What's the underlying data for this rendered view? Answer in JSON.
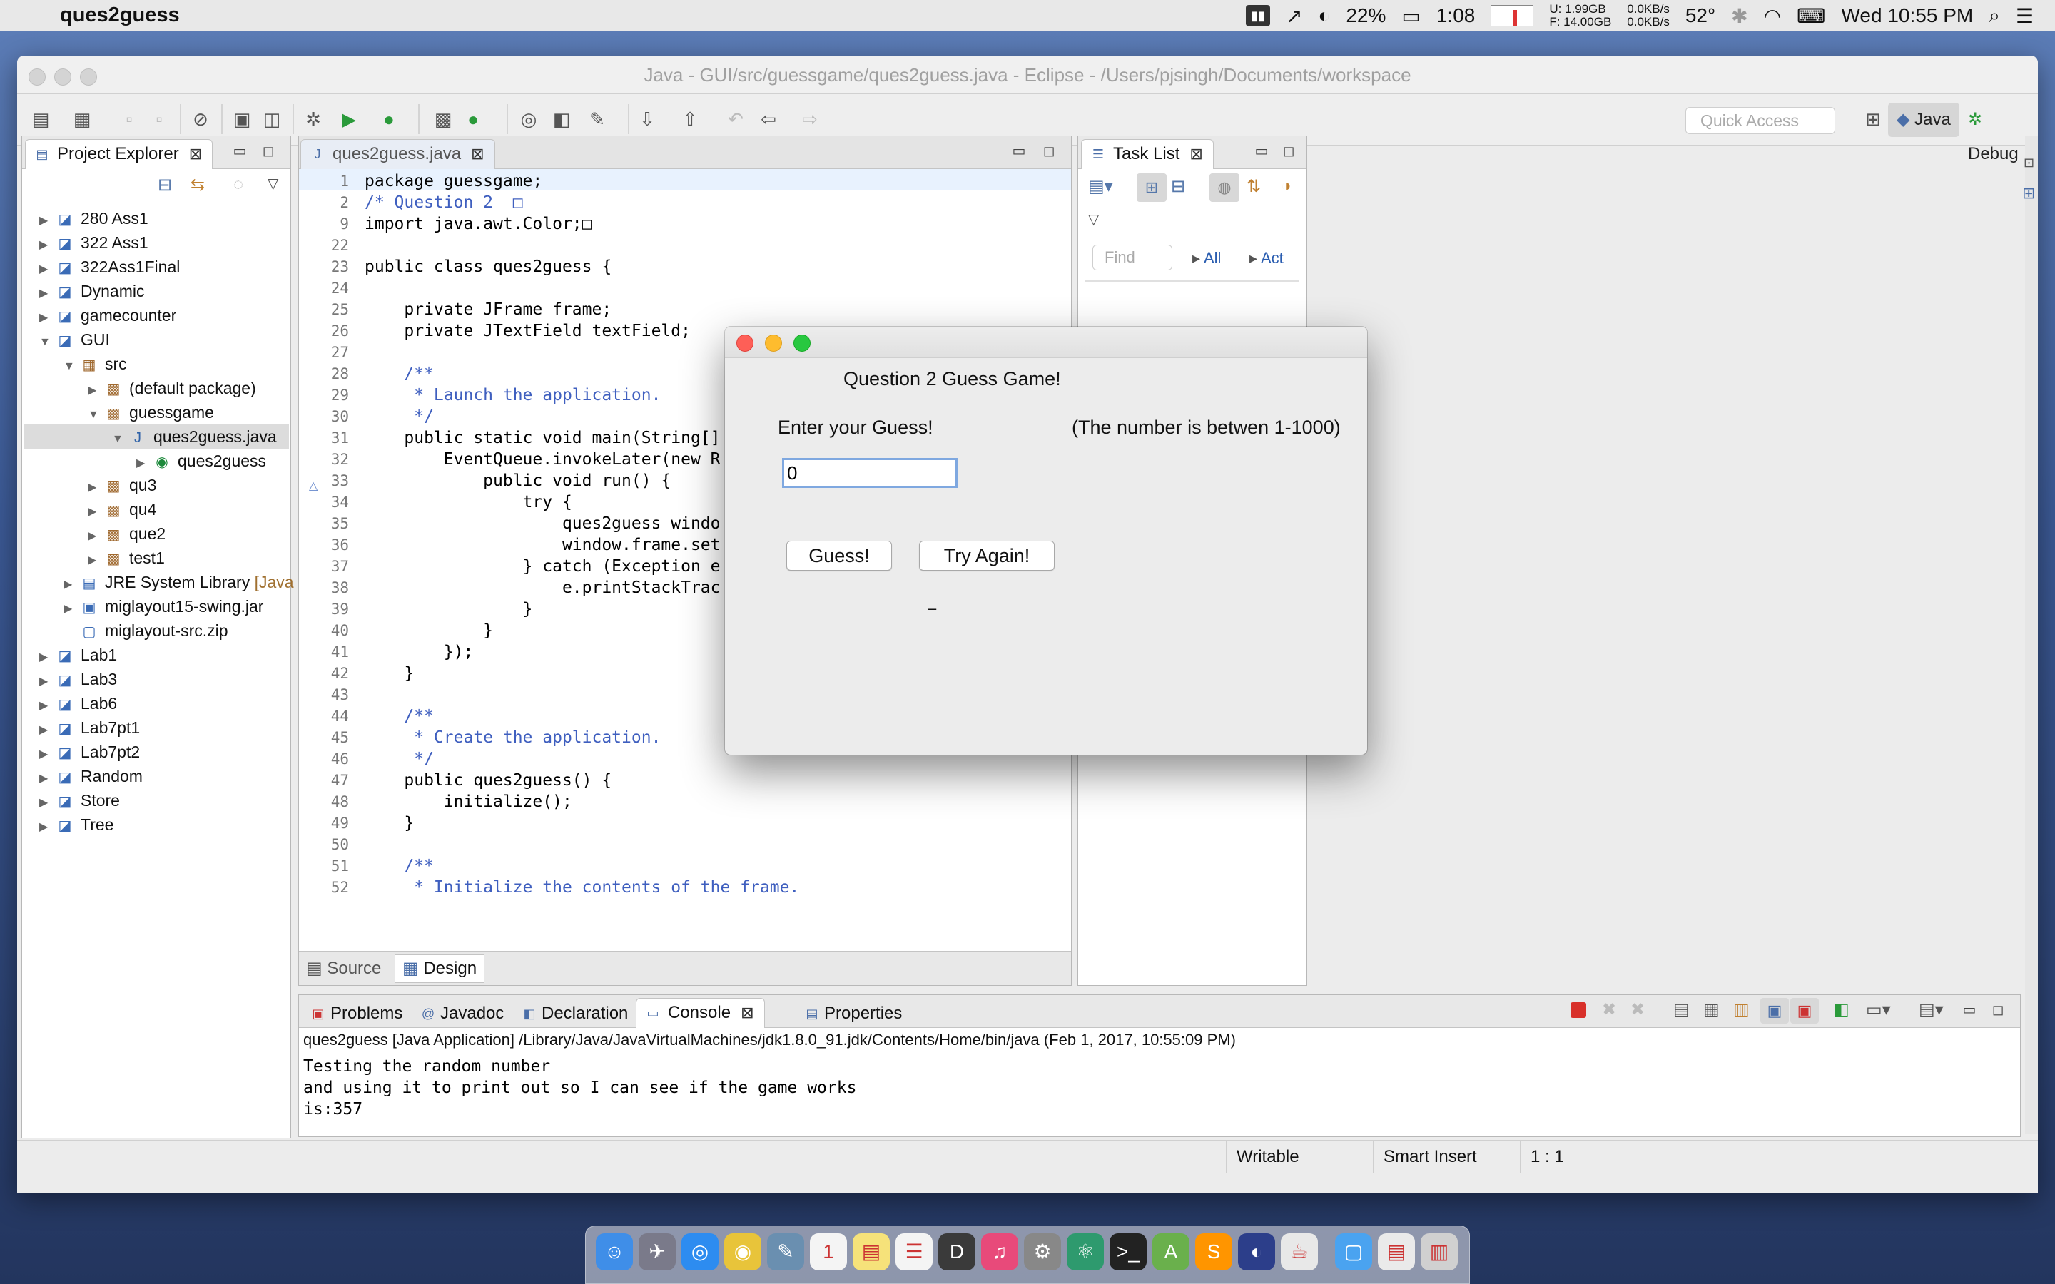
{
  "menubar": {
    "app_name": "ques2guess",
    "battery_percent": "22%",
    "battery_time": "1:08",
    "memory_used": "U:  1.99GB",
    "memory_free": "F: 14.00GB",
    "net_up": "0.0KB/s",
    "net_down": "0.0KB/s",
    "temperature": "52°",
    "clock": "Wed 10:55 PM"
  },
  "window": {
    "title": "Java - GUI/src/guessgame/ques2guess.java - Eclipse - /Users/pjsingh/Documents/workspace"
  },
  "toolbar": {
    "quick_access_placeholder": "Quick Access",
    "perspective_java": "Java",
    "perspective_debug": "Debug"
  },
  "project_explorer": {
    "tab_label": "Project Explorer",
    "items": [
      {
        "label": "280 Ass1",
        "depth": 0,
        "arrow": "▶",
        "icon": "project-icon"
      },
      {
        "label": "322 Ass1",
        "depth": 0,
        "arrow": "▶",
        "icon": "project-icon"
      },
      {
        "label": "322Ass1Final",
        "depth": 0,
        "arrow": "▶",
        "icon": "project-icon"
      },
      {
        "label": "Dynamic",
        "depth": 0,
        "arrow": "▶",
        "icon": "project-icon"
      },
      {
        "label": "gamecounter",
        "depth": 0,
        "arrow": "▶",
        "icon": "project-icon"
      },
      {
        "label": "GUI",
        "depth": 0,
        "arrow": "▼",
        "icon": "project-icon"
      },
      {
        "label": "src",
        "depth": 1,
        "arrow": "▼",
        "icon": "source-folder-icon"
      },
      {
        "label": "(default package)",
        "depth": 2,
        "arrow": "▶",
        "icon": "package-icon"
      },
      {
        "label": "guessgame",
        "depth": 2,
        "arrow": "▼",
        "icon": "package-icon"
      },
      {
        "label": "ques2guess.java",
        "depth": 3,
        "arrow": "▼",
        "icon": "java-file-icon"
      },
      {
        "label": "ques2guess",
        "depth": 4,
        "arrow": "▶",
        "icon": "class-icon"
      },
      {
        "label": "qu3",
        "depth": 2,
        "arrow": "▶",
        "icon": "package-icon"
      },
      {
        "label": "qu4",
        "depth": 2,
        "arrow": "▶",
        "icon": "package-icon"
      },
      {
        "label": "que2",
        "depth": 2,
        "arrow": "▶",
        "icon": "package-icon"
      },
      {
        "label": "test1",
        "depth": 2,
        "arrow": "▶",
        "icon": "package-icon"
      },
      {
        "label": "JRE System Library",
        "suffix": " [Java",
        "depth": 1,
        "arrow": "▶",
        "icon": "library-icon"
      },
      {
        "label": "miglayout15-swing.jar",
        "depth": 1,
        "arrow": "▶",
        "icon": "jar-icon"
      },
      {
        "label": "miglayout-src.zip",
        "depth": 1,
        "arrow": "",
        "icon": "zip-icon"
      },
      {
        "label": "Lab1",
        "depth": 0,
        "arrow": "▶",
        "icon": "project-icon"
      },
      {
        "label": "Lab3",
        "depth": 0,
        "arrow": "▶",
        "icon": "project-icon"
      },
      {
        "label": "Lab6",
        "depth": 0,
        "arrow": "▶",
        "icon": "project-icon"
      },
      {
        "label": "Lab7pt1",
        "depth": 0,
        "arrow": "▶",
        "icon": "project-icon"
      },
      {
        "label": "Lab7pt2",
        "depth": 0,
        "arrow": "▶",
        "icon": "project-icon"
      },
      {
        "label": "Random",
        "depth": 0,
        "arrow": "▶",
        "icon": "project-icon"
      },
      {
        "label": "Store",
        "depth": 0,
        "arrow": "▶",
        "icon": "project-icon"
      },
      {
        "label": "Tree",
        "depth": 0,
        "arrow": "▶",
        "icon": "project-icon"
      }
    ]
  },
  "editor": {
    "tab_label": "ques2guess.java",
    "lines": [
      {
        "n": "1",
        "text": "package guessgame;"
      },
      {
        "n": "2",
        "text": "/* Question 2  □"
      },
      {
        "n": "9",
        "text": "import java.awt.Color;□"
      },
      {
        "n": "22",
        "text": ""
      },
      {
        "n": "23",
        "text": "public class ques2guess {"
      },
      {
        "n": "24",
        "text": ""
      },
      {
        "n": "25",
        "text": "    private JFrame frame;"
      },
      {
        "n": "26",
        "text": "    private JTextField textField;"
      },
      {
        "n": "27",
        "text": ""
      },
      {
        "n": "28",
        "text": "    /**"
      },
      {
        "n": "29",
        "text": "     * Launch the application."
      },
      {
        "n": "30",
        "text": "     */"
      },
      {
        "n": "31",
        "text": "    public static void main(String[]"
      },
      {
        "n": "32",
        "text": "        EventQueue.invokeLater(new R"
      },
      {
        "n": "33",
        "text": "            public void run() {"
      },
      {
        "n": "34",
        "text": "                try {"
      },
      {
        "n": "35",
        "text": "                    ques2guess windo"
      },
      {
        "n": "36",
        "text": "                    window.frame.set"
      },
      {
        "n": "37",
        "text": "                } catch (Exception e"
      },
      {
        "n": "38",
        "text": "                    e.printStackTrac"
      },
      {
        "n": "39",
        "text": "                }"
      },
      {
        "n": "40",
        "text": "            }"
      },
      {
        "n": "41",
        "text": "        });"
      },
      {
        "n": "42",
        "text": "    }"
      },
      {
        "n": "43",
        "text": ""
      },
      {
        "n": "44",
        "text": "    /**"
      },
      {
        "n": "45",
        "text": "     * Create the application."
      },
      {
        "n": "46",
        "text": "     */"
      },
      {
        "n": "47",
        "text": "    public ques2guess() {"
      },
      {
        "n": "48",
        "text": "        initialize();"
      },
      {
        "n": "49",
        "text": "    }"
      },
      {
        "n": "50",
        "text": ""
      },
      {
        "n": "51",
        "text": "    /**"
      },
      {
        "n": "52",
        "text": "     * Initialize the contents of the frame."
      }
    ],
    "source_tab": "Source",
    "design_tab": "Design"
  },
  "task_list": {
    "tab_label": "Task List",
    "find_placeholder": "Find",
    "all_label": "All",
    "act_label": "Act"
  },
  "bottom_tabs": {
    "problems": "Problems",
    "javadoc": "Javadoc",
    "declaration": "Declaration",
    "console": "Console",
    "properties": "Properties"
  },
  "console": {
    "header": "ques2guess [Java Application] /Library/Java/JavaVirtualMachines/jdk1.8.0_91.jdk/Contents/Home/bin/java (Feb 1, 2017, 10:55:09 PM)",
    "lines": [
      "Testing the random number",
      "and using it to print out so I can see if the game works",
      "is:357"
    ]
  },
  "status_bar": {
    "writable": "Writable",
    "insert_mode": "Smart Insert",
    "position": "1 : 1"
  },
  "dialog": {
    "title_text": "Question 2 Guess Game!",
    "prompt": "Enter your Guess!",
    "hint": "(The number is betwen 1-1000)",
    "guess_value": "0",
    "guess_button": "Guess!",
    "try_again_button": "Try Again!",
    "result_text": "–"
  },
  "colors": {
    "keyword": "#7f0055",
    "comment": "#3f5fbf",
    "field": "#0000c0",
    "close_red": "#fe5f57",
    "minimize_yellow": "#febc2e",
    "zoom_green": "#28c840"
  },
  "dock": {
    "icons": [
      "finder-icon",
      "launchpad-icon",
      "safari-icon",
      "chrome-icon",
      "preview-icon",
      "calendar-icon",
      "notes-icon",
      "reminders-icon",
      "dash-icon",
      "itunes-icon",
      "system-preferences-icon",
      "atom-icon",
      "terminal-icon",
      "android-studio-icon",
      "sublime-icon",
      "eclipse-icon",
      "java-icon",
      "folder-icon",
      "documents-icon",
      "trash-icon"
    ],
    "calendar_date": "1"
  }
}
